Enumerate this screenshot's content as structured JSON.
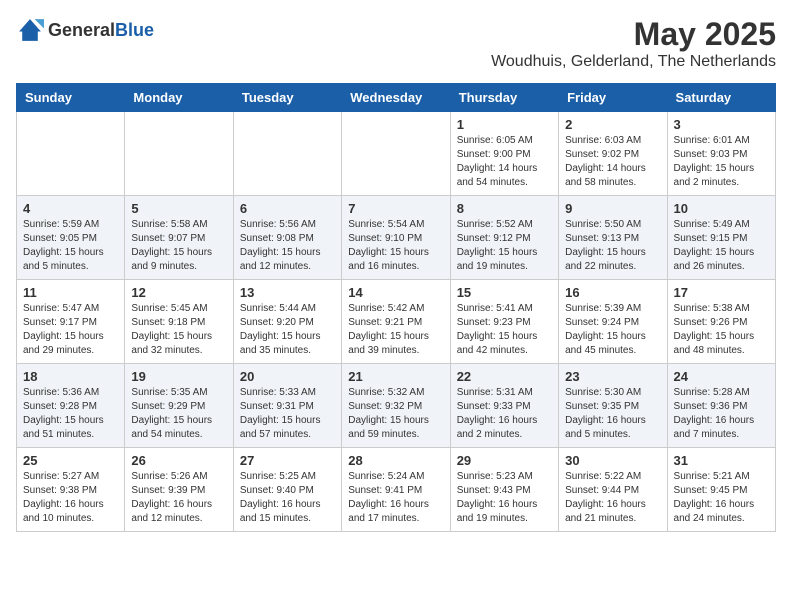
{
  "logo": {
    "general": "General",
    "blue": "Blue"
  },
  "title": "May 2025",
  "location": "Woudhuis, Gelderland, The Netherlands",
  "weekdays": [
    "Sunday",
    "Monday",
    "Tuesday",
    "Wednesday",
    "Thursday",
    "Friday",
    "Saturday"
  ],
  "weeks": [
    [
      {
        "day": "",
        "info": ""
      },
      {
        "day": "",
        "info": ""
      },
      {
        "day": "",
        "info": ""
      },
      {
        "day": "",
        "info": ""
      },
      {
        "day": "1",
        "info": "Sunrise: 6:05 AM\nSunset: 9:00 PM\nDaylight: 14 hours\nand 54 minutes."
      },
      {
        "day": "2",
        "info": "Sunrise: 6:03 AM\nSunset: 9:02 PM\nDaylight: 14 hours\nand 58 minutes."
      },
      {
        "day": "3",
        "info": "Sunrise: 6:01 AM\nSunset: 9:03 PM\nDaylight: 15 hours\nand 2 minutes."
      }
    ],
    [
      {
        "day": "4",
        "info": "Sunrise: 5:59 AM\nSunset: 9:05 PM\nDaylight: 15 hours\nand 5 minutes."
      },
      {
        "day": "5",
        "info": "Sunrise: 5:58 AM\nSunset: 9:07 PM\nDaylight: 15 hours\nand 9 minutes."
      },
      {
        "day": "6",
        "info": "Sunrise: 5:56 AM\nSunset: 9:08 PM\nDaylight: 15 hours\nand 12 minutes."
      },
      {
        "day": "7",
        "info": "Sunrise: 5:54 AM\nSunset: 9:10 PM\nDaylight: 15 hours\nand 16 minutes."
      },
      {
        "day": "8",
        "info": "Sunrise: 5:52 AM\nSunset: 9:12 PM\nDaylight: 15 hours\nand 19 minutes."
      },
      {
        "day": "9",
        "info": "Sunrise: 5:50 AM\nSunset: 9:13 PM\nDaylight: 15 hours\nand 22 minutes."
      },
      {
        "day": "10",
        "info": "Sunrise: 5:49 AM\nSunset: 9:15 PM\nDaylight: 15 hours\nand 26 minutes."
      }
    ],
    [
      {
        "day": "11",
        "info": "Sunrise: 5:47 AM\nSunset: 9:17 PM\nDaylight: 15 hours\nand 29 minutes."
      },
      {
        "day": "12",
        "info": "Sunrise: 5:45 AM\nSunset: 9:18 PM\nDaylight: 15 hours\nand 32 minutes."
      },
      {
        "day": "13",
        "info": "Sunrise: 5:44 AM\nSunset: 9:20 PM\nDaylight: 15 hours\nand 35 minutes."
      },
      {
        "day": "14",
        "info": "Sunrise: 5:42 AM\nSunset: 9:21 PM\nDaylight: 15 hours\nand 39 minutes."
      },
      {
        "day": "15",
        "info": "Sunrise: 5:41 AM\nSunset: 9:23 PM\nDaylight: 15 hours\nand 42 minutes."
      },
      {
        "day": "16",
        "info": "Sunrise: 5:39 AM\nSunset: 9:24 PM\nDaylight: 15 hours\nand 45 minutes."
      },
      {
        "day": "17",
        "info": "Sunrise: 5:38 AM\nSunset: 9:26 PM\nDaylight: 15 hours\nand 48 minutes."
      }
    ],
    [
      {
        "day": "18",
        "info": "Sunrise: 5:36 AM\nSunset: 9:28 PM\nDaylight: 15 hours\nand 51 minutes."
      },
      {
        "day": "19",
        "info": "Sunrise: 5:35 AM\nSunset: 9:29 PM\nDaylight: 15 hours\nand 54 minutes."
      },
      {
        "day": "20",
        "info": "Sunrise: 5:33 AM\nSunset: 9:31 PM\nDaylight: 15 hours\nand 57 minutes."
      },
      {
        "day": "21",
        "info": "Sunrise: 5:32 AM\nSunset: 9:32 PM\nDaylight: 15 hours\nand 59 minutes."
      },
      {
        "day": "22",
        "info": "Sunrise: 5:31 AM\nSunset: 9:33 PM\nDaylight: 16 hours\nand 2 minutes."
      },
      {
        "day": "23",
        "info": "Sunrise: 5:30 AM\nSunset: 9:35 PM\nDaylight: 16 hours\nand 5 minutes."
      },
      {
        "day": "24",
        "info": "Sunrise: 5:28 AM\nSunset: 9:36 PM\nDaylight: 16 hours\nand 7 minutes."
      }
    ],
    [
      {
        "day": "25",
        "info": "Sunrise: 5:27 AM\nSunset: 9:38 PM\nDaylight: 16 hours\nand 10 minutes."
      },
      {
        "day": "26",
        "info": "Sunrise: 5:26 AM\nSunset: 9:39 PM\nDaylight: 16 hours\nand 12 minutes."
      },
      {
        "day": "27",
        "info": "Sunrise: 5:25 AM\nSunset: 9:40 PM\nDaylight: 16 hours\nand 15 minutes."
      },
      {
        "day": "28",
        "info": "Sunrise: 5:24 AM\nSunset: 9:41 PM\nDaylight: 16 hours\nand 17 minutes."
      },
      {
        "day": "29",
        "info": "Sunrise: 5:23 AM\nSunset: 9:43 PM\nDaylight: 16 hours\nand 19 minutes."
      },
      {
        "day": "30",
        "info": "Sunrise: 5:22 AM\nSunset: 9:44 PM\nDaylight: 16 hours\nand 21 minutes."
      },
      {
        "day": "31",
        "info": "Sunrise: 5:21 AM\nSunset: 9:45 PM\nDaylight: 16 hours\nand 24 minutes."
      }
    ]
  ]
}
